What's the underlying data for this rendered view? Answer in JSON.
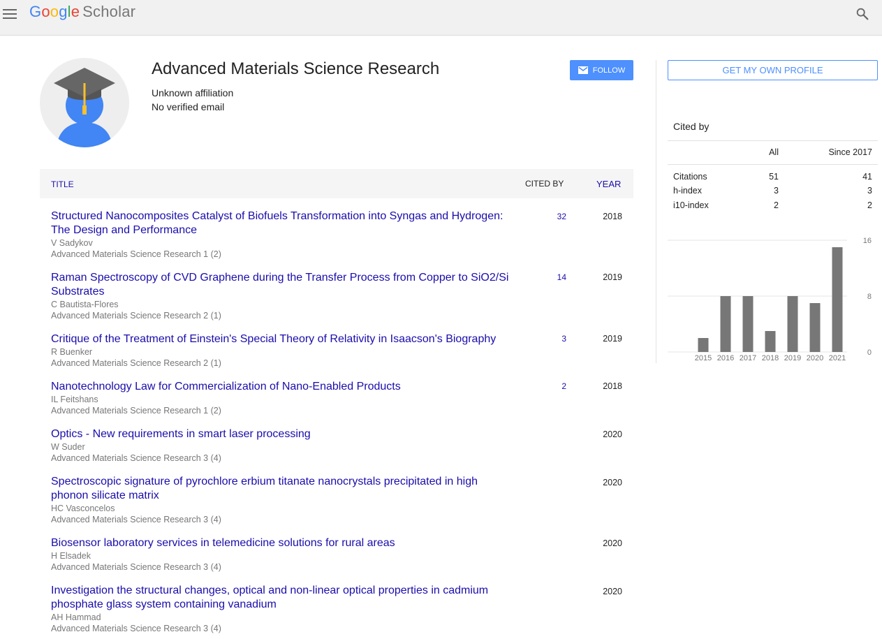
{
  "header": {
    "logo_letters": [
      "G",
      "o",
      "o",
      "g",
      "l",
      "e"
    ],
    "logo_suffix": "Scholar"
  },
  "profile": {
    "name": "Advanced Materials Science Research",
    "affiliation": "Unknown affiliation",
    "email": "No verified email",
    "follow_label": "FOLLOW"
  },
  "table": {
    "col_title": "TITLE",
    "col_cited": "CITED BY",
    "col_year": "YEAR",
    "rows": [
      {
        "title": "Structured Nanocomposites Catalyst of Biofuels Transformation into Syngas and Hydrogen: The Design and Performance",
        "authors": "V Sadykov",
        "venue": "Advanced Materials Science Research 1 (2)",
        "cited": "32",
        "year": "2018"
      },
      {
        "title": "Raman Spectroscopy of CVD Graphene during the Transfer Process from Copper to SiO2/Si Substrates",
        "authors": "C Bautista-Flores",
        "venue": "Advanced Materials Science Research 2 (1)",
        "cited": "14",
        "year": "2019"
      },
      {
        "title": "Critique of the Treatment of Einstein's Special Theory of Relativity in Isaacson's Biography",
        "authors": "R Buenker",
        "venue": "Advanced Materials Science Research 2 (1)",
        "cited": "3",
        "year": "2019"
      },
      {
        "title": "Nanotechnology Law for Commercialization of Nano-Enabled Products",
        "authors": "IL Feitshans",
        "venue": "Advanced Materials Science Research 1 (2)",
        "cited": "2",
        "year": "2018"
      },
      {
        "title": "Optics - New requirements in smart laser processing",
        "authors": "W Suder",
        "venue": "Advanced Materials Science Research 3 (4)",
        "cited": "",
        "year": "2020"
      },
      {
        "title": "Spectroscopic signature of pyrochlore erbium titanate nanocrystals precipitated in high phonon silicate matrix",
        "authors": "HC Vasconcelos",
        "venue": "Advanced Materials Science Research 3 (4)",
        "cited": "",
        "year": "2020"
      },
      {
        "title": "Biosensor laboratory services in telemedicine solutions for rural areas",
        "authors": "H Elsadek",
        "venue": "Advanced Materials Science Research 3 (4)",
        "cited": "",
        "year": "2020"
      },
      {
        "title": "Investigation the structural changes, optical and non-linear optical properties in cadmium phosphate glass system containing vanadium",
        "authors": "AH Hammad",
        "venue": "Advanced Materials Science Research 3 (4)",
        "cited": "",
        "year": "2020"
      }
    ]
  },
  "sidebar": {
    "own_profile_label": "GET MY OWN PROFILE",
    "cited_by_title": "Cited by",
    "col_all": "All",
    "col_since": "Since 2017",
    "metrics": [
      {
        "label": "Citations",
        "all": "51",
        "since": "41"
      },
      {
        "label": "h-index",
        "all": "3",
        "since": "3"
      },
      {
        "label": "i10-index",
        "all": "2",
        "since": "2"
      }
    ]
  },
  "chart_data": {
    "type": "bar",
    "categories": [
      "2015",
      "2016",
      "2017",
      "2018",
      "2019",
      "2020",
      "2021"
    ],
    "values": [
      2,
      8,
      8,
      3,
      8,
      7,
      15
    ],
    "ylim": [
      0,
      16
    ],
    "yticks": [
      0,
      8,
      16
    ],
    "grid": true,
    "bar_color": "#777777"
  },
  "colors": {
    "link": "#1a0dab",
    "accent": "#4d90fe",
    "avatar_body": "#4285f4",
    "avatar_cap": "#666666",
    "avatar_tassel": "#fbc02d"
  }
}
